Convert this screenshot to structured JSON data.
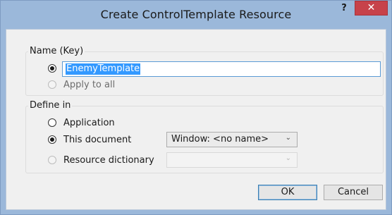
{
  "window": {
    "title": "Create ControlTemplate Resource",
    "help_glyph": "?",
    "close_glyph": "✕"
  },
  "name_group": {
    "label": "Name (Key)",
    "key_value": "EnemyTemplate",
    "apply_label": "Apply to all"
  },
  "define_group": {
    "label": "Define in",
    "application_label": "Application",
    "this_document_label": "This document",
    "this_document_combo": "Window: <no name>",
    "resource_dict_label": "Resource dictionary",
    "resource_dict_combo": ""
  },
  "buttons": {
    "ok_label": "OK",
    "cancel_label": "Cancel"
  },
  "icons": {
    "combo_arrow": "chevron-down-icon"
  }
}
